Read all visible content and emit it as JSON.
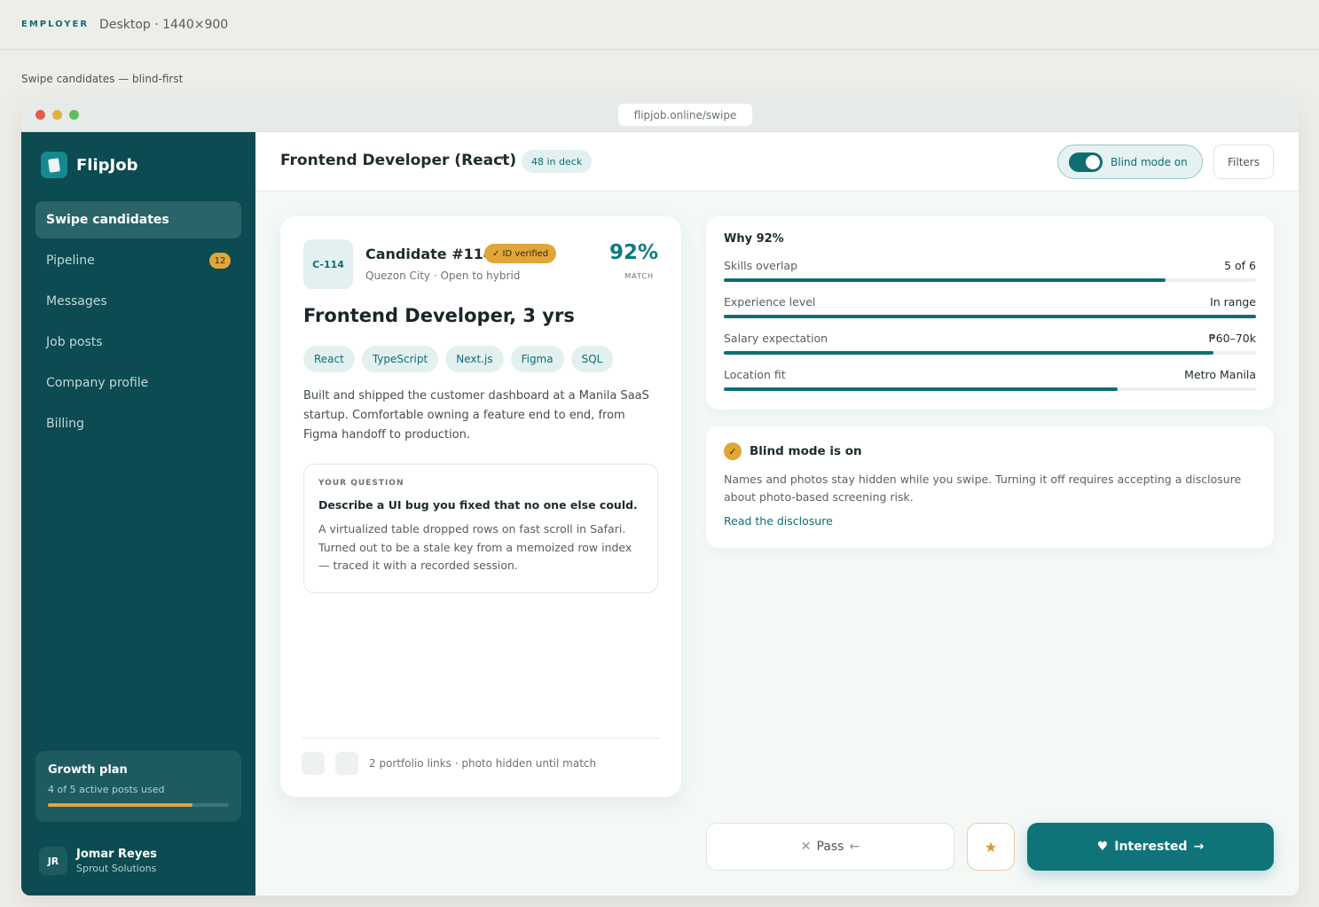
{
  "topbar": {
    "tag": "EMPLOYER",
    "title": "Desktop · 1440×900"
  },
  "caption": "Swipe candidates — blind-first",
  "browser": {
    "url": "flipjob.online/swipe"
  },
  "sidebar": {
    "brand": "FlipJob",
    "items": [
      {
        "label": "Swipe candidates",
        "active": true
      },
      {
        "label": "Pipeline",
        "badge": "12"
      },
      {
        "label": "Messages"
      },
      {
        "label": "Job posts"
      },
      {
        "label": "Company profile"
      },
      {
        "label": "Billing"
      }
    ],
    "plan": {
      "title": "Growth plan",
      "usage": "4 of 5 active posts used",
      "fraction": 0.8
    },
    "user": {
      "initials": "JR",
      "name": "Jomar Reyes",
      "company": "Sprout Solutions"
    }
  },
  "header": {
    "job_title": "Frontend Developer (React)",
    "caret": "▾",
    "deck_count": "48 in deck",
    "blind_toggle": "Blind mode on",
    "filters": "Filters"
  },
  "candidate": {
    "id": "C-114",
    "name": "Candidate #114",
    "verified": "✓ ID verified",
    "location": "Quezon City · Open to hybrid",
    "match": "92%",
    "match_label": "MATCH",
    "role": "Frontend Developer, 3 yrs",
    "skills": [
      "React",
      "TypeScript",
      "Next.js",
      "Figma",
      "SQL"
    ],
    "bio": "Built and shipped the customer dashboard at a Manila SaaS startup. Comfortable owning a feature end to end, from Figma handoff to production.",
    "question_label": "YOUR QUESTION",
    "question": "Describe a UI bug you fixed that no one else could.",
    "answer": "A virtualized table dropped rows on fast scroll in Safari. Turned out to be a stale key from a memoized row index — traced it with a recorded session.",
    "footer": "2 portfolio links · photo hidden until match"
  },
  "why": {
    "title": "Why 92%",
    "factors": [
      {
        "label": "Skills overlap",
        "value": "5 of 6",
        "level": 0.83
      },
      {
        "label": "Experience level",
        "value": "In range",
        "level": 1.0
      },
      {
        "label": "Salary expectation",
        "value": "₱60–70k",
        "level": 0.92
      },
      {
        "label": "Location fit",
        "value": "Metro Manila",
        "level": 0.74
      }
    ]
  },
  "blind_panel": {
    "check": "✓",
    "title": "Blind mode is on",
    "text": "Names and photos stay hidden while you swipe. Turning it off requires accepting a disclosure about photo-based screening risk.",
    "link": "Read the disclosure"
  },
  "actions": {
    "pass_icon": "✕",
    "pass": "Pass",
    "pass_arrow": "←",
    "star": "★",
    "interested_icon": "♥",
    "interested": "Interested",
    "interested_arrow": "→"
  },
  "colors": {
    "sidebar": "#0b4b51",
    "accent": "#0e6e74",
    "amber": "#e0a63a"
  }
}
